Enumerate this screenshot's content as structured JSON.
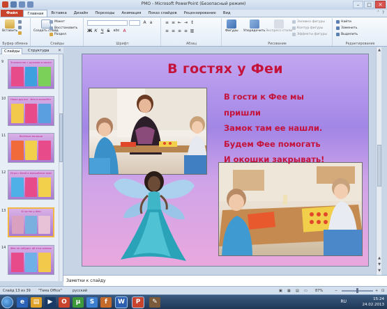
{
  "window": {
    "title": "PMO - Microsoft PowerPoint (Безопасный режим)",
    "minimize": "–",
    "maximize": "□",
    "close": "✕"
  },
  "ribbon_tabs": [
    {
      "label": "Файл"
    },
    {
      "label": "Главная"
    },
    {
      "label": "Вставка"
    },
    {
      "label": "Дизайн"
    },
    {
      "label": "Переходы"
    },
    {
      "label": "Анимация"
    },
    {
      "label": "Показ слайдов"
    },
    {
      "label": "Рецензирование"
    },
    {
      "label": "Вид"
    }
  ],
  "ribbon": {
    "clipboard": {
      "paste": "Вставить",
      "group": "Буфер обмена"
    },
    "slides": {
      "create": "Создать слайд",
      "layout": "Макет",
      "reset": "Восстановить",
      "section": "Раздел",
      "group": "Слайды"
    },
    "font": {
      "group": "Шрифт",
      "bold": "Ж",
      "italic": "К",
      "underline": "Ч",
      "strike": "S",
      "shadow": "abc"
    },
    "paragraph": {
      "group": "Абзац"
    },
    "drawing": {
      "shapes": "Фигуры",
      "arrange": "Упорядочить",
      "quick_styles": "Экспресс-стили",
      "fill": "Заливка фигуры",
      "outline": "Контур фигуры",
      "effects": "Эффекты фигуры",
      "group": "Рисование"
    },
    "editing": {
      "find": "Найти",
      "replace": "Заменить",
      "select": "Выделить",
      "group": "Редактирование"
    }
  },
  "left_pane": {
    "tab_slides": "Слайды",
    "tab_outline": "Структура",
    "close": "✕",
    "thumbnails": [
      {
        "num": "9",
        "title": "Знакомство с ручками и маленькими",
        "colors": [
          "#e84b8a",
          "#3fa0e0",
          "#7bd05a"
        ]
      },
      {
        "num": "10",
        "title": "Наши друзья - Феи в волшебстве",
        "colors": [
          "#f3c94b",
          "#e84b8a",
          "#5aa0e0"
        ]
      },
      {
        "num": "11",
        "title": "Весёлые малыши",
        "colors": [
          "#f06a3a",
          "#f3d04b",
          "#e84b8a"
        ]
      },
      {
        "num": "12",
        "title": "Игра с Феей в волшебном замке",
        "colors": [
          "#4fb0e8",
          "#e84b8a",
          "#f3d04b"
        ]
      },
      {
        "num": "13",
        "title": "В гостях у Феи",
        "colors": [
          "#d9a0c0",
          "#7ab0e0",
          "#e8c3d8"
        ]
      },
      {
        "num": "14",
        "title": "Фея не забудет об этих малышах",
        "colors": [
          "#e84b8a",
          "#6fb0e8",
          "#f3c94b"
        ]
      }
    ]
  },
  "slide": {
    "title": "В гостях у Феи",
    "lines": [
      "В гости к Фее мы",
      "пришли",
      "Замок там ее нашли.",
      "Будем Фее помогать",
      "И окошки закрывать!"
    ]
  },
  "notes": {
    "placeholder": "Заметки к слайду"
  },
  "status": {
    "slide_info": "Слайд 13 из 39",
    "theme": "\"Тема Office\"",
    "language": "русский",
    "zoom": "87%"
  },
  "taskbar": {
    "lang": "RU",
    "time": "15:24",
    "date": "24.02.2013"
  },
  "colors": {
    "accent": "#c8442c",
    "slide_text": "#c4123a"
  }
}
